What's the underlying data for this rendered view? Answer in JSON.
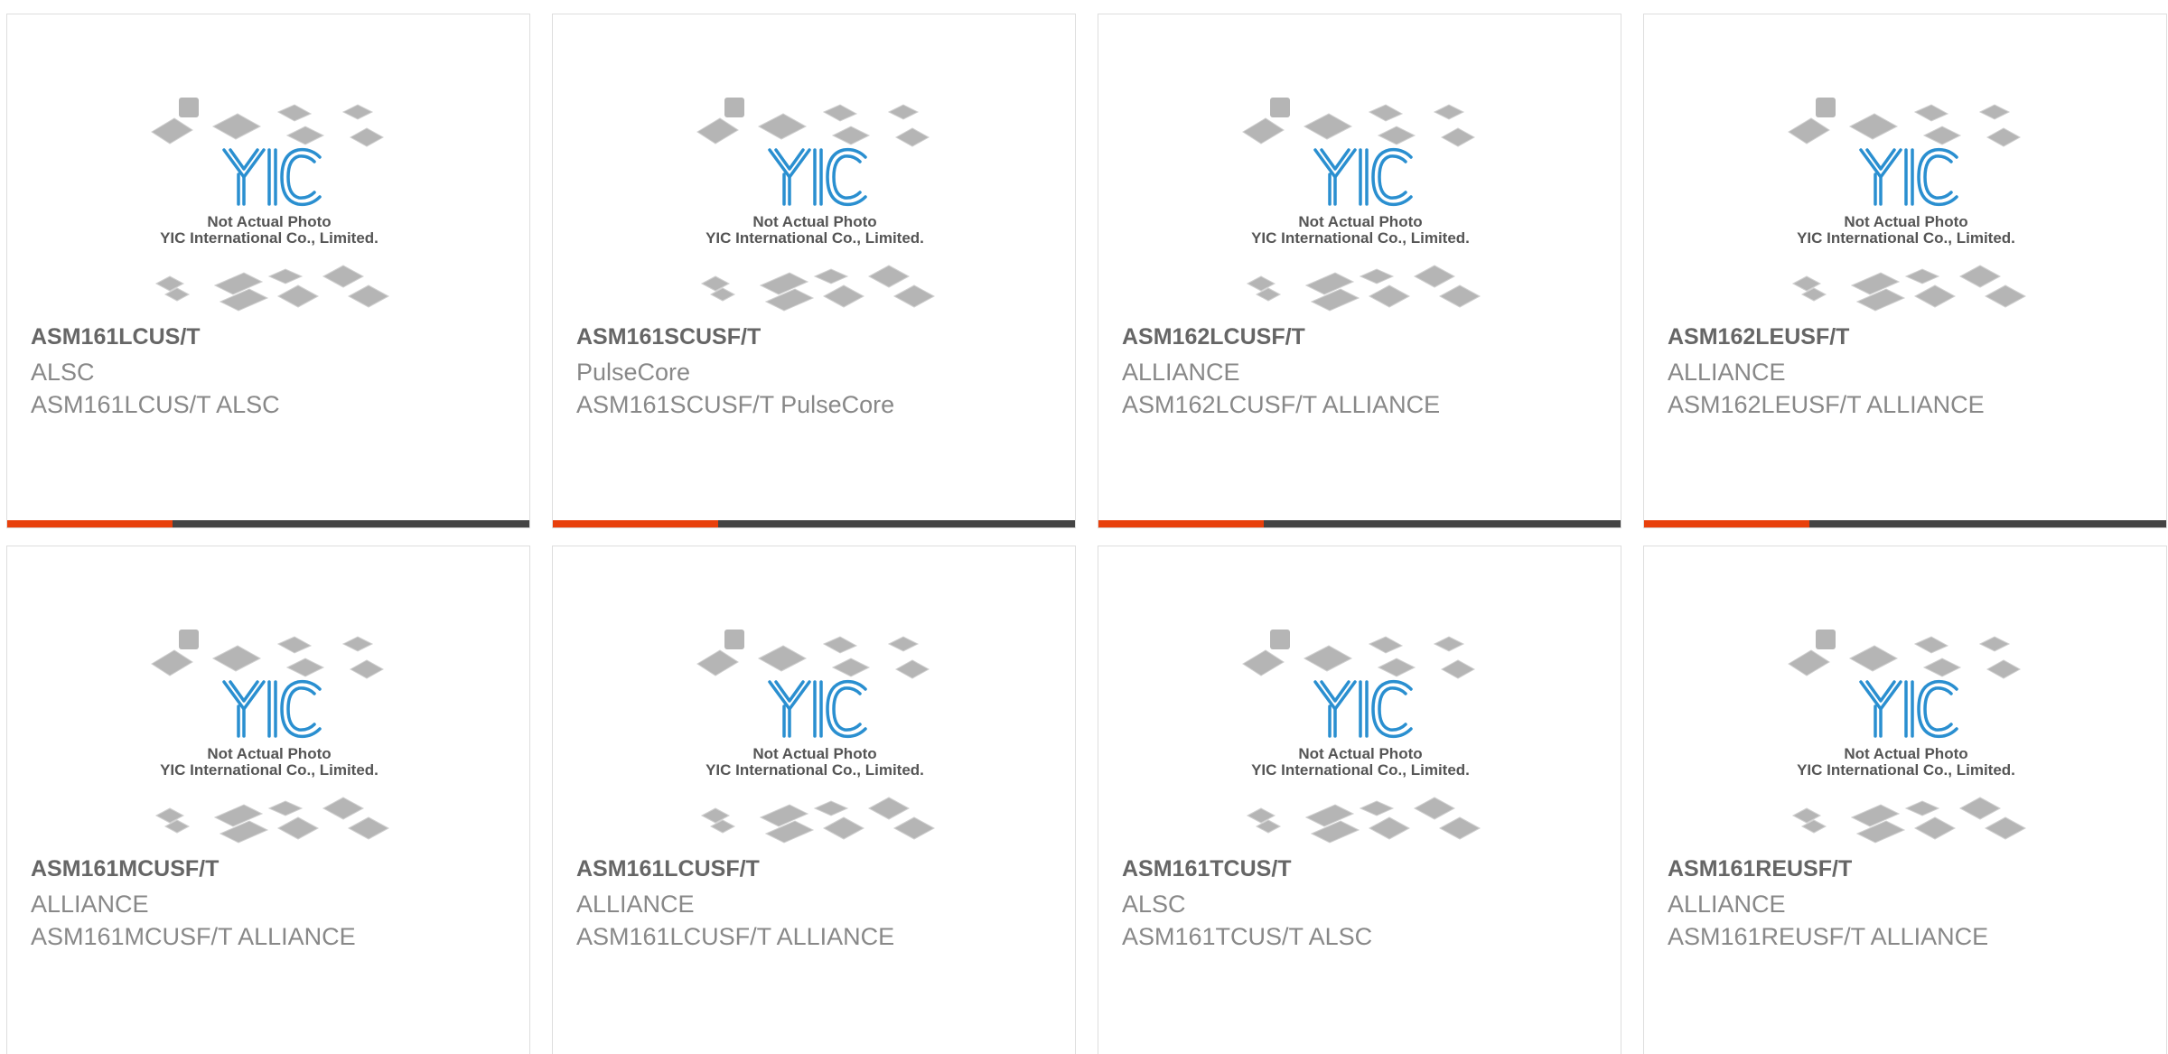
{
  "image": {
    "caption_line1": "Not Actual Photo",
    "caption_line2": "YIC International Co., Limited.",
    "logo": "YIC"
  },
  "colors": {
    "accent": "#e8400c",
    "bar": "#444444",
    "logo_blue": "#2a8fd0",
    "chip_gray": "#b5b5b5"
  },
  "products": [
    {
      "part": "ASM161LCUS/T",
      "brand": "ALSC",
      "description": "ASM161LCUS/T ALSC"
    },
    {
      "part": "ASM161SCUSF/T",
      "brand": "PulseCore",
      "description": "ASM161SCUSF/T PulseCore"
    },
    {
      "part": "ASM162LCUSF/T",
      "brand": "ALLIANCE",
      "description": "ASM162LCUSF/T ALLIANCE"
    },
    {
      "part": "ASM162LEUSF/T",
      "brand": "ALLIANCE",
      "description": "ASM162LEUSF/T ALLIANCE"
    },
    {
      "part": "ASM161MCUSF/T",
      "brand": "ALLIANCE",
      "description": "ASM161MCUSF/T ALLIANCE"
    },
    {
      "part": "ASM161LCUSF/T",
      "brand": "ALLIANCE",
      "description": "ASM161LCUSF/T ALLIANCE"
    },
    {
      "part": "ASM161TCUS/T",
      "brand": "ALSC",
      "description": "ASM161TCUS/T ALSC"
    },
    {
      "part": "ASM161REUSF/T",
      "brand": "ALLIANCE",
      "description": "ASM161REUSF/T ALLIANCE"
    }
  ]
}
